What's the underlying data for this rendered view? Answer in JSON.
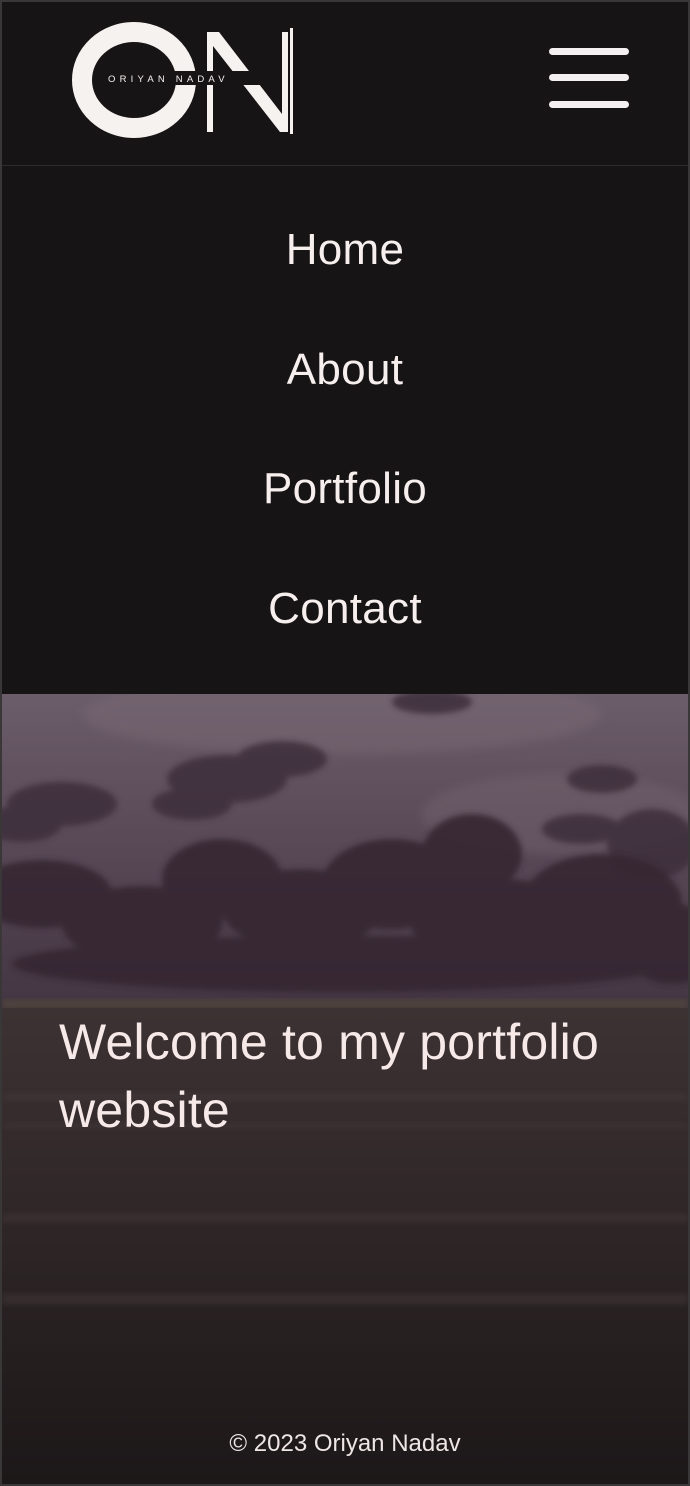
{
  "header": {
    "logo": {
      "initials": "ON",
      "name": "ORIYAN NADAV"
    },
    "menu_icon": "hamburger-icon"
  },
  "nav": {
    "items": [
      {
        "label": "Home"
      },
      {
        "label": "About"
      },
      {
        "label": "Portfolio"
      },
      {
        "label": "Contact"
      }
    ]
  },
  "hero": {
    "title": "Welcome to my portfolio website"
  },
  "footer": {
    "copyright": "© 2023 Oriyan Nadav"
  },
  "colors": {
    "background": "#171415",
    "text": "#f7eeee"
  }
}
